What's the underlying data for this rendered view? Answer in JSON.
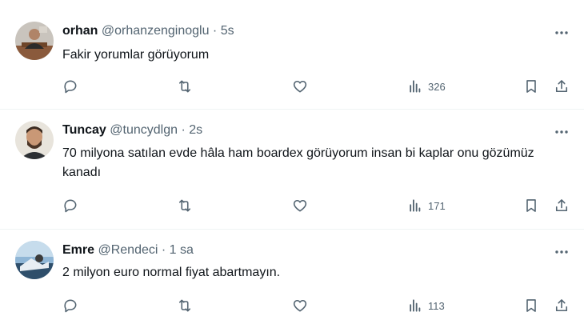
{
  "tweets": [
    {
      "name": "orhan",
      "handle": "@orhanzenginoglu",
      "separator": "·",
      "time": "5s",
      "text": "Fakir yorumlar görüyorum",
      "views": "326"
    },
    {
      "name": "Tuncay",
      "handle": "@tuncydlgn",
      "separator": "·",
      "time": "2s",
      "text": "70 milyona satılan evde hâla ham boardex görüyorum insan bi kaplar onu gözümüz kanadı",
      "views": "171"
    },
    {
      "name": "Emre",
      "handle": "@Rendeci",
      "separator": "·",
      "time": "1 sa",
      "text": "2 milyon euro normal fiyat abartmayın.",
      "views": "113"
    }
  ],
  "icons": {
    "reply": "reply-icon",
    "retweet": "retweet-icon",
    "like": "like-icon",
    "views": "views-icon",
    "bookmark": "bookmark-icon",
    "share": "share-icon",
    "more": "more-options-icon"
  },
  "colors": {
    "text": "#0f1419",
    "secondary": "#536471",
    "divider": "#eff3f4"
  }
}
